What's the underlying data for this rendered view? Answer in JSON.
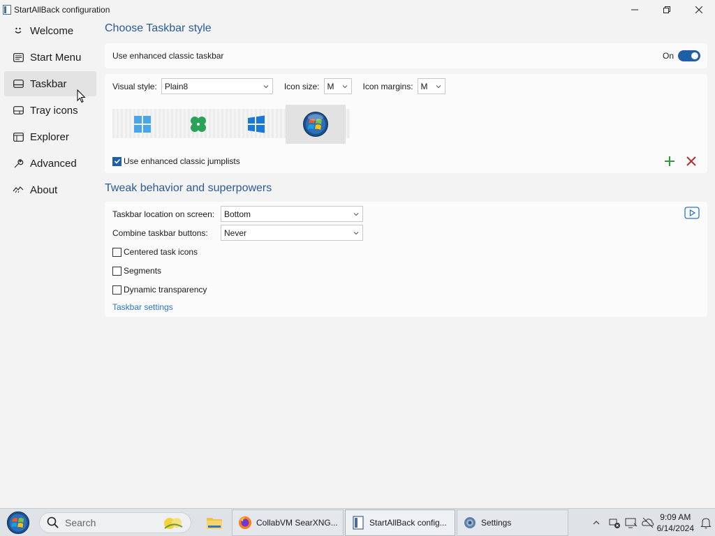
{
  "window": {
    "title": "StartAllBack configuration"
  },
  "sidebar": {
    "items": [
      {
        "label": "Welcome",
        "icon": "smile-icon"
      },
      {
        "label": "Start Menu",
        "icon": "start-menu-icon"
      },
      {
        "label": "Taskbar",
        "icon": "taskbar-icon",
        "active": true
      },
      {
        "label": "Tray icons",
        "icon": "tray-icon"
      },
      {
        "label": "Explorer",
        "icon": "explorer-icon"
      },
      {
        "label": "Advanced",
        "icon": "wrench-icon"
      },
      {
        "label": "About",
        "icon": "about-icon"
      }
    ]
  },
  "taskbar_style": {
    "section_title": "Choose Taskbar style",
    "enhanced_label": "Use enhanced classic taskbar",
    "toggle_state": "On",
    "visual_style_label": "Visual style:",
    "visual_style_value": "Plain8",
    "icon_size_label": "Icon size:",
    "icon_size_value": "M",
    "icon_margins_label": "Icon margins:",
    "icon_margins_value": "M",
    "styles": [
      "windows-11-icon",
      "clover-icon",
      "windows-10-icon",
      "windows-7-orb-icon"
    ],
    "jumplists_label": "Use enhanced classic jumplists",
    "jumplists_checked": true
  },
  "tweak": {
    "section_title": "Tweak behavior and superpowers",
    "location_label": "Taskbar location on screen:",
    "location_value": "Bottom",
    "combine_label": "Combine taskbar buttons:",
    "combine_value": "Never",
    "centered_label": "Centered task icons",
    "segments_label": "Segments",
    "dynamic_label": "Dynamic transparency",
    "settings_link": "Taskbar settings"
  },
  "taskbar": {
    "search_placeholder": "Search",
    "apps": [
      {
        "label": "CollabVM SearXNG...",
        "icon": "firefox-icon"
      },
      {
        "label": "StartAllBack config...",
        "icon": "startallback-icon",
        "active": true
      },
      {
        "label": "Settings",
        "icon": "settings-gear-icon"
      }
    ],
    "time": "9:09 AM",
    "date": "6/14/2024"
  },
  "colors": {
    "accent": "#1f5fa8",
    "section_title": "#2a5a9a",
    "link": "#2a74c4",
    "add_green": "#2e9a3a",
    "delete_red": "#b03030"
  }
}
